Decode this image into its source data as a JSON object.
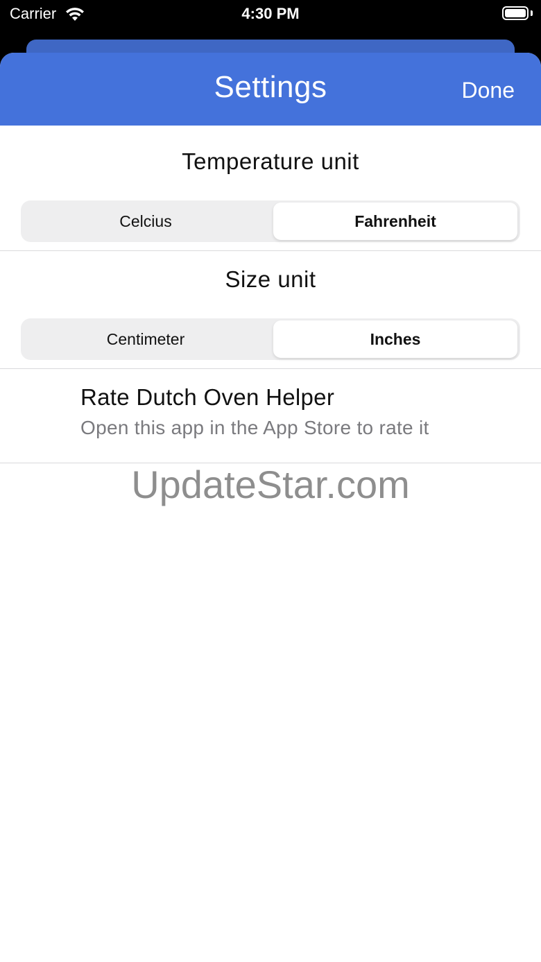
{
  "status_bar": {
    "carrier": "Carrier",
    "time": "4:30 PM",
    "wifi_icon": "wifi-icon",
    "battery_icon": "battery-icon"
  },
  "nav": {
    "title": "Settings",
    "done_label": "Done",
    "color": "#4472db"
  },
  "temperature": {
    "title": "Temperature unit",
    "options": [
      "Celcius",
      "Fahrenheit"
    ],
    "selected": "Fahrenheit"
  },
  "size": {
    "title": "Size unit",
    "options": [
      "Centimeter",
      "Inches"
    ],
    "selected": "Inches"
  },
  "rate": {
    "title": "Rate Dutch Oven Helper",
    "subtitle": "Open this app in the App Store to rate it"
  },
  "watermark": "UpdateStar.com"
}
